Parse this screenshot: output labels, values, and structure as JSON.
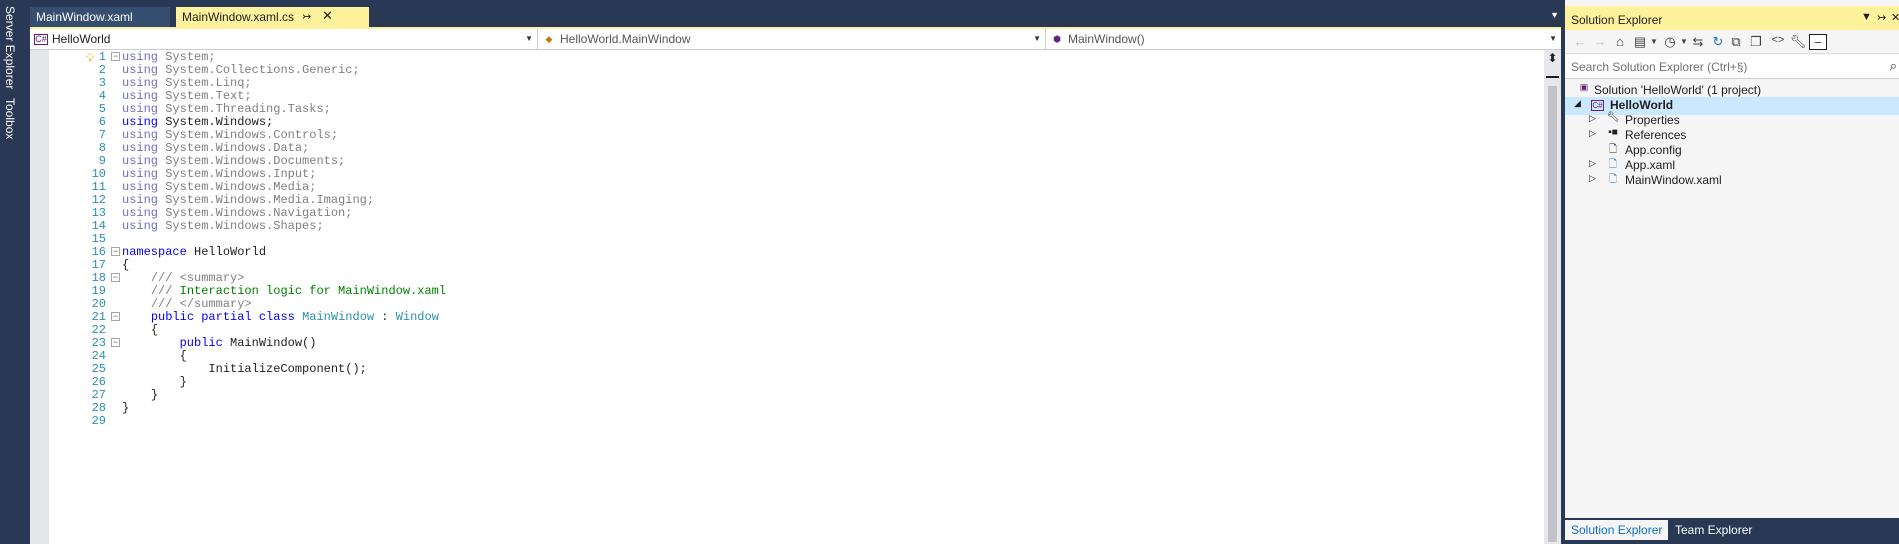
{
  "left_strip": {
    "server_explorer": "Server Explorer",
    "toolbox": "Toolbox"
  },
  "editor": {
    "tabs": [
      {
        "label": "MainWindow.xaml"
      },
      {
        "label": "MainWindow.xaml.cs"
      }
    ],
    "nav": {
      "project": "HelloWorld",
      "type": "HelloWorld.MainWindow",
      "member": "MainWindow()"
    },
    "lines": [
      {
        "n": "1"
      },
      {
        "n": "2"
      },
      {
        "n": "3"
      },
      {
        "n": "4"
      },
      {
        "n": "5"
      },
      {
        "n": "6"
      },
      {
        "n": "7"
      },
      {
        "n": "8"
      },
      {
        "n": "9"
      },
      {
        "n": "10"
      },
      {
        "n": "11"
      },
      {
        "n": "12"
      },
      {
        "n": "13"
      },
      {
        "n": "14"
      },
      {
        "n": "15"
      },
      {
        "n": "16"
      },
      {
        "n": "17"
      },
      {
        "n": "18"
      },
      {
        "n": "19"
      },
      {
        "n": "20"
      },
      {
        "n": "21"
      },
      {
        "n": "22"
      },
      {
        "n": "23"
      },
      {
        "n": "24"
      },
      {
        "n": "25"
      },
      {
        "n": "26"
      },
      {
        "n": "27"
      },
      {
        "n": "28"
      },
      {
        "n": "29"
      }
    ],
    "code": {
      "kw_using": "using",
      "ns_system": "System;",
      "ns_generic": "System.Collections.Generic;",
      "ns_linq": "System.Linq;",
      "ns_text": "System.Text;",
      "ns_tasks": "System.Threading.Tasks;",
      "ns_windows": "System.Windows;",
      "ns_controls": "System.Windows.Controls;",
      "ns_data": "System.Windows.Data;",
      "ns_documents": "System.Windows.Documents;",
      "ns_input": "System.Windows.Input;",
      "ns_media": "System.Windows.Media;",
      "ns_imaging": "System.Windows.Media.Imaging;",
      "ns_navigation": "System.Windows.Navigation;",
      "ns_shapes": "System.Windows.Shapes;",
      "kw_namespace": "namespace",
      "namespace_name": "HelloWorld",
      "open_brace": "{",
      "close_brace": "}",
      "doc_slashes": "///",
      "summary_open": "<summary>",
      "summary_text": "Interaction logic for MainWindow.xaml",
      "summary_close": "</summary>",
      "kw_public": "public",
      "kw_partial": "partial",
      "kw_class": "class",
      "class_name": "MainWindow",
      "colon": ":",
      "base_class": "Window",
      "ctor": "MainWindow()",
      "init_call": "InitializeComponent();"
    }
  },
  "solution_explorer": {
    "title": "Solution Explorer",
    "search_placeholder": "Search Solution Explorer (Ctrl+§)",
    "tree": {
      "solution": "Solution 'HelloWorld' (1 project)",
      "project": "HelloWorld",
      "properties": "Properties",
      "references": "References",
      "app_config": "App.config",
      "app_xaml": "App.xaml",
      "main_window_xaml": "MainWindow.xaml"
    },
    "bottom_tabs": {
      "solution_explorer": "Solution Explorer",
      "team_explorer": "Team Explorer"
    }
  },
  "colors": {
    "chrome": "#293955",
    "active_tab": "#fff29d",
    "keyword": "#0000ff",
    "type": "#2b91af",
    "comment": "#008000",
    "line_number": "#2b91af"
  }
}
